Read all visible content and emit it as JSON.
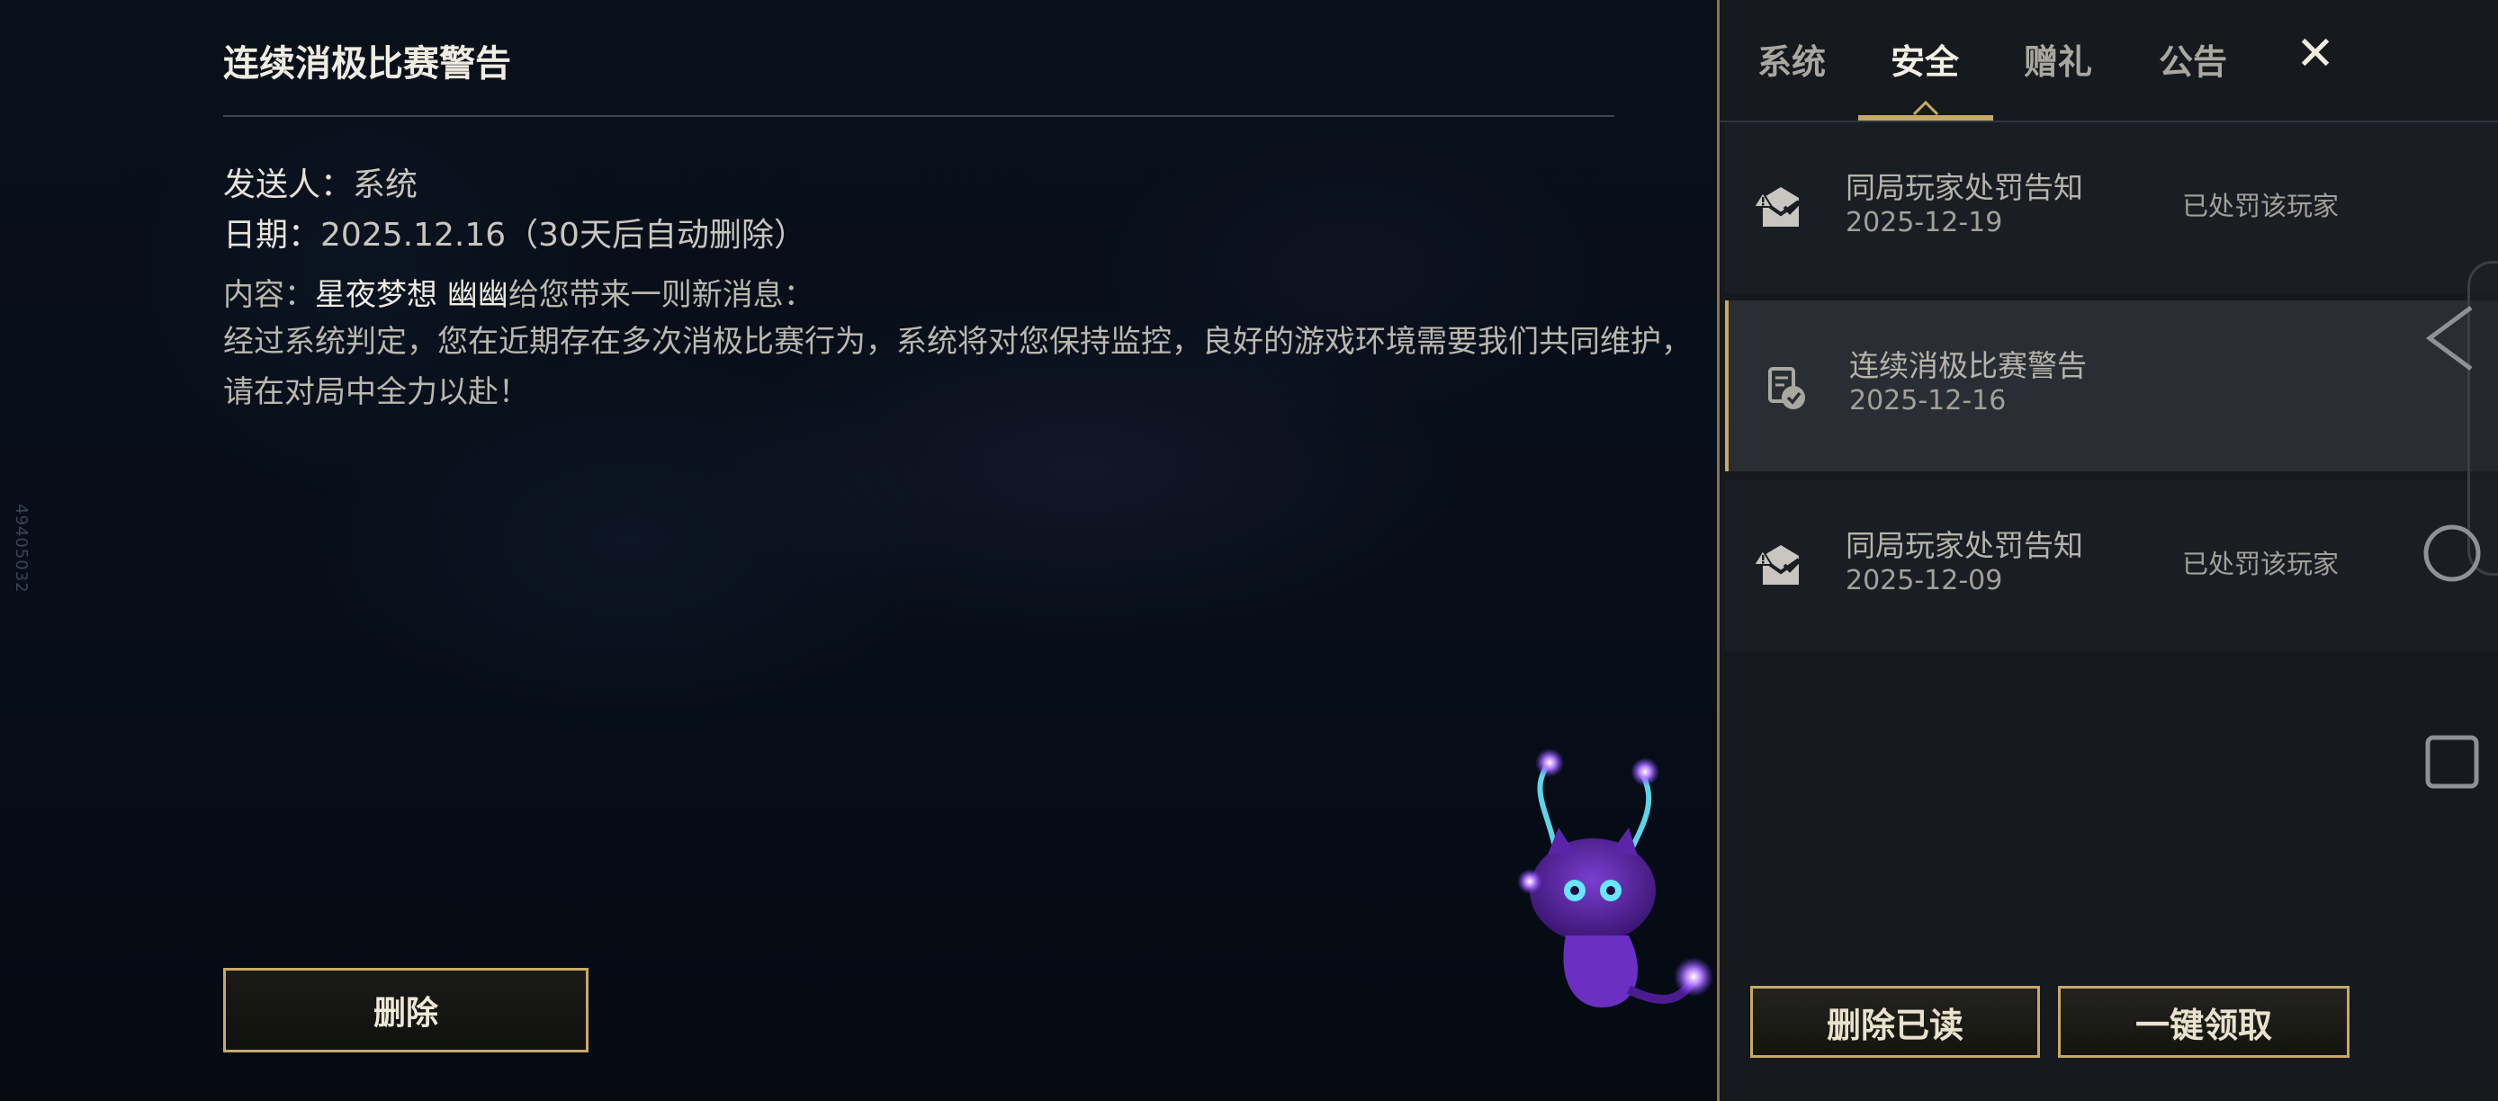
{
  "side_id": "49405032",
  "detail": {
    "title": "连续消极比赛警告",
    "sender_label": "发送人：",
    "sender_value": "系统",
    "date_label": "日期：",
    "date_value": "2025.12.16（30天后自动删除）",
    "content_label": "内容：",
    "content_from": "星夜梦想 幽幽",
    "content_intro": "给您带来一则新消息：",
    "body": "经过系统判定，您在近期存在多次消极比赛行为，系统将对您保持监控，良好的游戏环境需要我们共同维护，请在对局中全力以赴！",
    "delete_button": "删除"
  },
  "tabs": [
    {
      "label": "系统",
      "active": false
    },
    {
      "label": "安全",
      "active": true
    },
    {
      "label": "赠礼",
      "active": false
    },
    {
      "label": "公告",
      "active": false
    }
  ],
  "close_label": "✕",
  "mail_list": [
    {
      "title": "同局玩家处罚告知",
      "date": "2025-12-19",
      "status": "已处罚该玩家",
      "icon": "mail-warning-icon",
      "selected": false
    },
    {
      "title": "连续消极比赛警告",
      "date": "2025-12-16",
      "status": "",
      "icon": "document-check-icon",
      "selected": true
    },
    {
      "title": "同局玩家处罚告知",
      "date": "2025-12-09",
      "status": "已处罚该玩家",
      "icon": "mail-warning-icon",
      "selected": false
    }
  ],
  "footer": {
    "delete_read": "删除已读",
    "claim_all": "一键领取"
  },
  "colors": {
    "gold": "#c8a964",
    "panel_bg": "#16191e",
    "selected_bg": "#2a2e34"
  }
}
